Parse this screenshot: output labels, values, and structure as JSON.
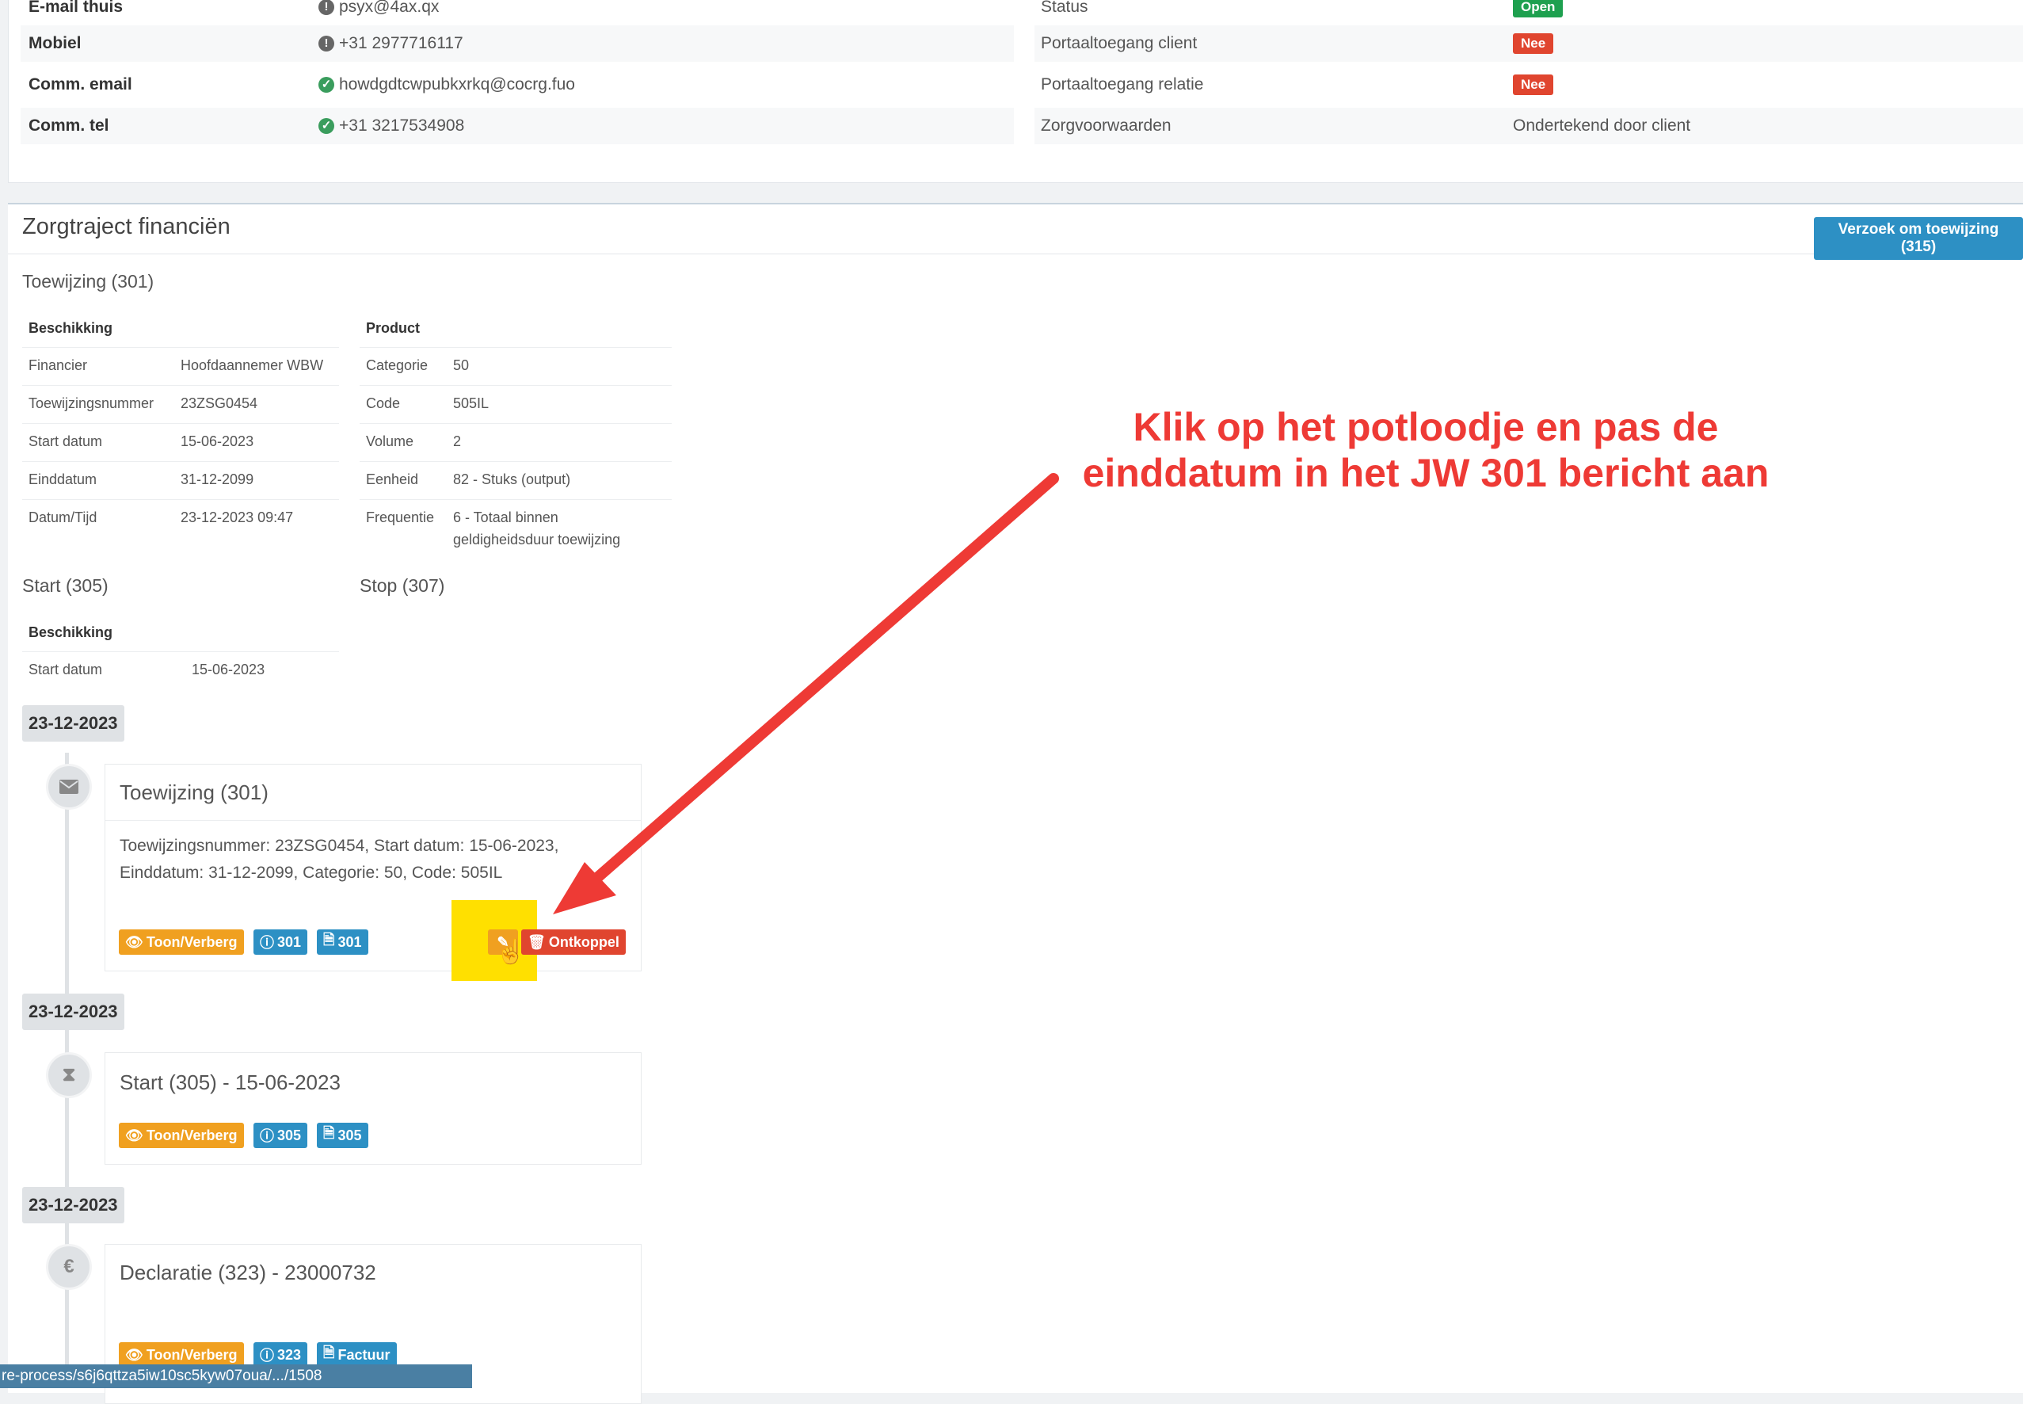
{
  "contact": {
    "rows": [
      {
        "label": "E-mail thuis",
        "value": "psyx@4ax.qx",
        "status": "warn"
      },
      {
        "label": "Mobiel",
        "value": "+31 2977716117",
        "status": "warn"
      },
      {
        "label": "Comm. email",
        "value": "howdgdtcwpubkxrkq@cocrg.fuo",
        "status": "ok"
      },
      {
        "label": "Comm. tel",
        "value": "+31 3217534908",
        "status": "ok"
      }
    ],
    "right_rows": [
      {
        "label": "Status",
        "value": "Open"
      },
      {
        "label": "Portaaltoegang client",
        "value": "Nee"
      },
      {
        "label": "Portaaltoegang relatie",
        "value": "Nee"
      },
      {
        "label": "Zorgvoorwaarden",
        "value": "Ondertekend door client"
      }
    ]
  },
  "finance": {
    "title": "Zorgtraject financiën",
    "request_button": "Verzoek om toewijzing (315)",
    "toewijzing_title": "Toewijzing (301)",
    "beschikking_head": "Beschikking",
    "beschikking": [
      {
        "k": "Financier",
        "v": "Hoofdaannemer WBW"
      },
      {
        "k": "Toewijzingsnummer",
        "v": "23ZSG0454"
      },
      {
        "k": "Start datum",
        "v": "15-06-2023"
      },
      {
        "k": "Einddatum",
        "v": "31-12-2099"
      },
      {
        "k": "Datum/Tijd",
        "v": "23-12-2023 09:47"
      }
    ],
    "product_head": "Product",
    "product": [
      {
        "k": "Categorie",
        "v": "50"
      },
      {
        "k": "Code",
        "v": "505IL"
      },
      {
        "k": "Volume",
        "v": "2"
      },
      {
        "k": "Eenheid",
        "v": "82 - Stuks (output)"
      },
      {
        "k": "Frequentie",
        "v": "6 - Totaal binnen",
        "v2": "geldigheidsduur toewijzing"
      }
    ],
    "start_title": "Start (305)",
    "stop_title": "Stop (307)",
    "start_beschikking_head": "Beschikking",
    "start_rows": [
      {
        "k": "Start datum",
        "v": "15-06-2023"
      }
    ]
  },
  "timeline": [
    {
      "date": "23-12-2023",
      "icon": "envelope-icon",
      "title": "Toewijzing (301)",
      "body_line1": "Toewijzingsnummer: 23ZSG0454, Start datum: 15-06-2023,",
      "body_line2": "Einddatum: 31-12-2099, Categorie: 50, Code: 505IL",
      "btn_toggle": "Toon/Verberg",
      "btn_info": "301",
      "btn_pdf": "301",
      "btn_unlink": "Ontkoppel"
    },
    {
      "date": "23-12-2023",
      "icon": "hourglass-icon",
      "title": "Start (305) - 15-06-2023",
      "btn_toggle": "Toon/Verberg",
      "btn_info": "305",
      "btn_pdf": "305"
    },
    {
      "date": "23-12-2023",
      "icon": "euro-icon",
      "title": "Declaratie (323) - 23000732",
      "btn_toggle": "Toon/Verberg",
      "btn_info": "323",
      "btn_pdf": "Factuur"
    }
  ],
  "annotation": {
    "line1": "Klik op het potloodje en pas de",
    "line2": "einddatum in het JW 301 bericht aan",
    "color": "#ee3a35"
  },
  "status_bar": "re-process/s6j6qttza5iw10sc5kyw07oua/.../1508",
  "colors": {
    "orange": "#f0a020",
    "blue": "#2d90c4",
    "red": "#e0452f",
    "green": "#1ea04f"
  }
}
